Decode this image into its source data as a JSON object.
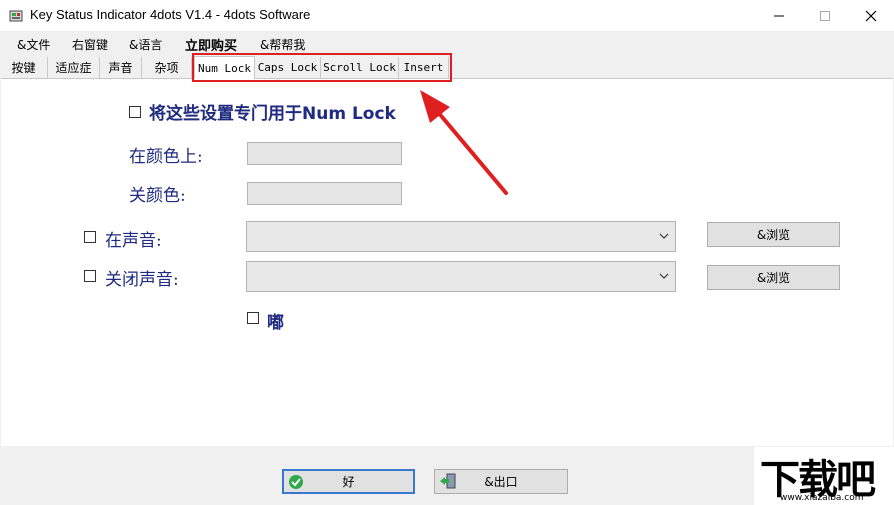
{
  "window": {
    "title": "Key Status Indicator 4dots V1.4 - 4dots Software"
  },
  "menu": {
    "items": [
      "&文件",
      "右窗键",
      "&语言",
      "立即购买",
      "&帮帮我"
    ]
  },
  "tabs": {
    "items": [
      "按键",
      "适应症",
      "声音",
      "杂项",
      "Num Lock",
      "Caps Lock",
      "Scroll Lock",
      "Insert"
    ],
    "active": "Num Lock"
  },
  "panel": {
    "use_settings_label": "将这些设置专门用于Num Lock",
    "on_color_label": "在颜色上:",
    "off_color_label": "关颜色:",
    "on_sound_label": "在声音:",
    "off_sound_label": "关闭声音:",
    "browse_label": "&浏览",
    "beep_label": "嘟"
  },
  "buttons": {
    "ok_label": "好",
    "exit_label": "&出口"
  },
  "watermark": {
    "brand": "下载吧",
    "url": "www.xiazaiba.com"
  },
  "colors": {
    "label_blue": "#1f2a80",
    "highlight_red": "#e02020",
    "ok_icon_green": "#2fa84a"
  }
}
